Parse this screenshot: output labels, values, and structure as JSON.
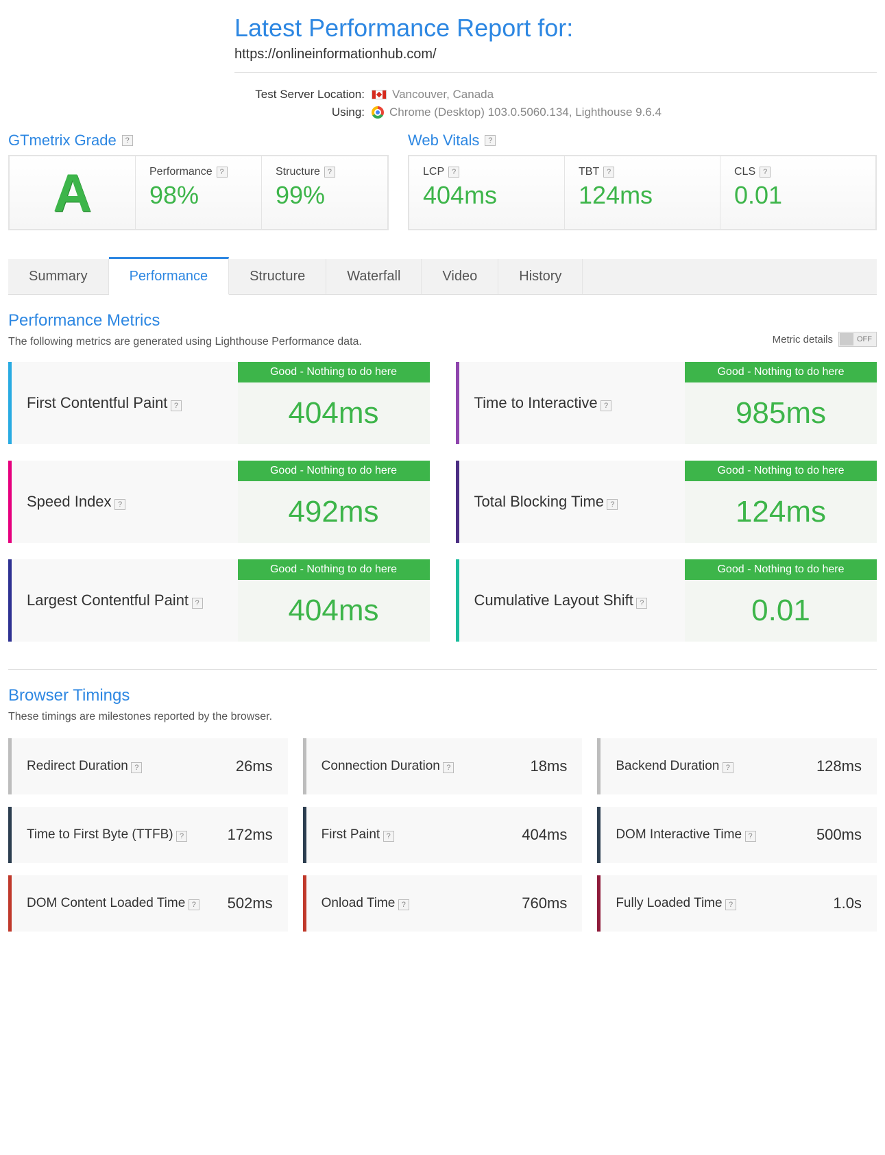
{
  "header": {
    "title": "Latest Performance Report for:",
    "url": "https://onlineinformationhub.com/",
    "location_label": "Test Server Location:",
    "location_value": "Vancouver, Canada",
    "using_label": "Using:",
    "using_value": "Chrome (Desktop) 103.0.5060.134, Lighthouse 9.6.4"
  },
  "sections": {
    "gtmetrix_label": "GTmetrix Grade",
    "webvitals_label": "Web Vitals"
  },
  "grade": {
    "letter": "A",
    "performance_label": "Performance",
    "performance_value": "98%",
    "structure_label": "Structure",
    "structure_value": "99%"
  },
  "vitals": {
    "lcp_label": "LCP",
    "lcp_value": "404ms",
    "tbt_label": "TBT",
    "tbt_value": "124ms",
    "cls_label": "CLS",
    "cls_value": "0.01"
  },
  "tabs": [
    "Summary",
    "Performance",
    "Structure",
    "Waterfall",
    "Video",
    "History"
  ],
  "active_tab": "Performance",
  "perf_section": {
    "title": "Performance Metrics",
    "subtitle": "The following metrics are generated using Lighthouse Performance data.",
    "toggle_label": "Metric details",
    "toggle_state": "OFF"
  },
  "good_text": "Good - Nothing to do here",
  "metrics": [
    {
      "name": "First Contentful Paint",
      "value": "404ms",
      "color": "c-cyan"
    },
    {
      "name": "Time to Interactive",
      "value": "985ms",
      "color": "c-purple"
    },
    {
      "name": "Speed Index",
      "value": "492ms",
      "color": "c-pink"
    },
    {
      "name": "Total Blocking Time",
      "value": "124ms",
      "color": "c-dpurple"
    },
    {
      "name": "Largest Contentful Paint",
      "value": "404ms",
      "color": "c-blue"
    },
    {
      "name": "Cumulative Layout Shift",
      "value": "0.01",
      "color": "c-teal"
    }
  ],
  "timings_section": {
    "title": "Browser Timings",
    "subtitle": "These timings are milestones reported by the browser."
  },
  "timings": [
    {
      "name": "Redirect Duration",
      "value": "26ms",
      "color": "t-gray"
    },
    {
      "name": "Connection Duration",
      "value": "18ms",
      "color": "t-gray"
    },
    {
      "name": "Backend Duration",
      "value": "128ms",
      "color": "t-gray"
    },
    {
      "name": "Time to First Byte (TTFB)",
      "value": "172ms",
      "color": "t-navy"
    },
    {
      "name": "First Paint",
      "value": "404ms",
      "color": "t-navy"
    },
    {
      "name": "DOM Interactive Time",
      "value": "500ms",
      "color": "t-navy"
    },
    {
      "name": "DOM Content Loaded Time",
      "value": "502ms",
      "color": "t-mag"
    },
    {
      "name": "Onload Time",
      "value": "760ms",
      "color": "t-mag"
    },
    {
      "name": "Fully Loaded Time",
      "value": "1.0s",
      "color": "t-dred"
    }
  ]
}
